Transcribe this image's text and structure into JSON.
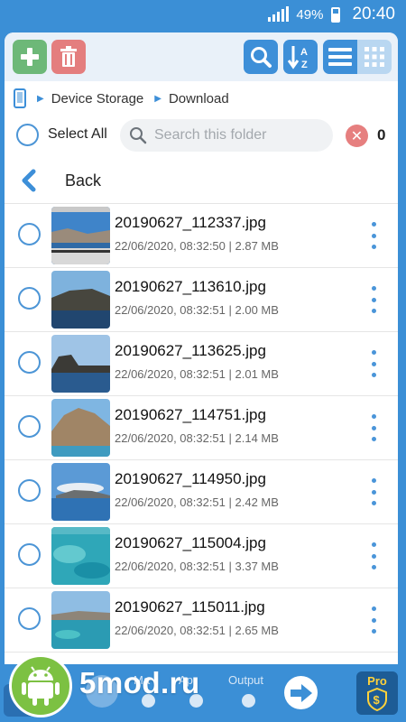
{
  "status_bar": {
    "battery": "49%",
    "time": "20:40"
  },
  "toolbar": {
    "add_icon": "plus-icon",
    "delete_icon": "trash-icon",
    "search_icon": "magnifier-icon",
    "sort_icon": "sort-az-icon",
    "list_icon": "list-view-icon",
    "grid_icon": "grid-view-icon"
  },
  "breadcrumb": {
    "root": "Device Storage",
    "current": "Download"
  },
  "selection": {
    "select_all_label": "Select All",
    "search_placeholder": "Search this folder",
    "selected_count": "0"
  },
  "back_label": "Back",
  "files": [
    {
      "name": "20190627_112337.jpg",
      "meta": "22/06/2020, 08:32:50 | 2.87 MB"
    },
    {
      "name": "20190627_113610.jpg",
      "meta": "22/06/2020, 08:32:51 | 2.00 MB"
    },
    {
      "name": "20190627_113625.jpg",
      "meta": "22/06/2020, 08:32:51 | 2.01 MB"
    },
    {
      "name": "20190627_114751.jpg",
      "meta": "22/06/2020, 08:32:51 | 2.14 MB"
    },
    {
      "name": "20190627_114950.jpg",
      "meta": "22/06/2020, 08:32:51 | 2.42 MB"
    },
    {
      "name": "20190627_115004.jpg",
      "meta": "22/06/2020, 08:32:51 | 3.37 MB"
    },
    {
      "name": "20190627_115011.jpg",
      "meta": "22/06/2020, 08:32:51 | 2.65 MB"
    }
  ],
  "bottom_bar": {
    "step_partial_1": "Ma",
    "step_partial_2": "Ap",
    "step_output": "Output",
    "pro_label": "Pro"
  },
  "watermark": {
    "text": "5mod.ru"
  },
  "colors": {
    "primary": "#3b8fd6",
    "add_green": "#6db878",
    "delete_red": "#e47e7e",
    "pro_gold": "#ffd23a"
  }
}
